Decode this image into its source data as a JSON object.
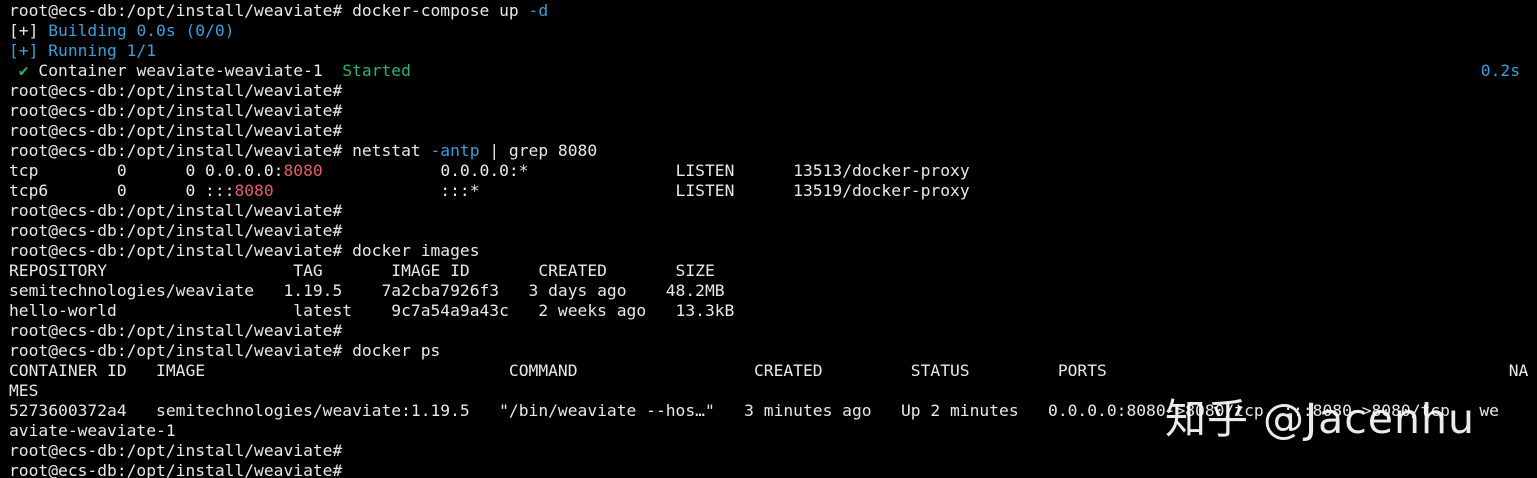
{
  "colors": {
    "background": "#000000",
    "text": "#e8e8e8",
    "blue": "#3b9fd6",
    "green": "#2fb36b",
    "red": "#e06060"
  },
  "lines": [
    [
      {
        "t": "root@ecs-db:/opt/install/weaviate# docker-compose up "
      },
      {
        "t": "-d",
        "c": "blue"
      }
    ],
    [
      {
        "t": "[+] "
      },
      {
        "t": "Building 0.0s (0/0)",
        "c": "blue"
      }
    ],
    [
      {
        "t": "[+] Running 1/1",
        "c": "blue"
      }
    ],
    [
      {
        "t": " ✔ ",
        "c": "green"
      },
      {
        "t": "Container weaviate-weaviate-1  "
      },
      {
        "t": "Started",
        "c": "green"
      }
    ],
    [
      {
        "t": "root@ecs-db:/opt/install/weaviate#"
      }
    ],
    [
      {
        "t": "root@ecs-db:/opt/install/weaviate#"
      }
    ],
    [
      {
        "t": "root@ecs-db:/opt/install/weaviate#"
      }
    ],
    [
      {
        "t": "root@ecs-db:/opt/install/weaviate# netstat "
      },
      {
        "t": "-antp",
        "c": "blue"
      },
      {
        "t": " | grep 8080"
      }
    ],
    [
      {
        "t": "tcp        0      0 0.0.0.0:"
      },
      {
        "t": "8080",
        "c": "red"
      },
      {
        "t": "            0.0.0.0:*               LISTEN      13513/docker-proxy"
      }
    ],
    [
      {
        "t": "tcp6       0      0 :::"
      },
      {
        "t": "8080",
        "c": "red"
      },
      {
        "t": "                 :::*                    LISTEN      13519/docker-proxy"
      }
    ],
    [
      {
        "t": "root@ecs-db:/opt/install/weaviate#"
      }
    ],
    [
      {
        "t": "root@ecs-db:/opt/install/weaviate#"
      }
    ],
    [
      {
        "t": "root@ecs-db:/opt/install/weaviate# docker images"
      }
    ],
    [
      {
        "t": "REPOSITORY                   TAG       IMAGE ID       CREATED       SIZE"
      }
    ],
    [
      {
        "t": "semitechnologies/weaviate   1.19.5    7a2cba7926f3   3 days ago    48.2MB"
      }
    ],
    [
      {
        "t": "hello-world                  latest    9c7a54a9a43c   2 weeks ago   13.3kB"
      }
    ],
    [
      {
        "t": "root@ecs-db:/opt/install/weaviate#"
      }
    ],
    [
      {
        "t": "root@ecs-db:/opt/install/weaviate# docker ps"
      }
    ],
    [
      {
        "t": "CONTAINER ID   IMAGE                               COMMAND                  CREATED         STATUS         PORTS                                         NA"
      }
    ],
    [
      {
        "t": "MES"
      }
    ],
    [
      {
        "t": "5273600372a4   semitechnologies/weaviate:1.19.5   \"/bin/weaviate --hos…\"   3 minutes ago   Up 2 minutes   0.0.0.0:8080->8080/tcp, :::8080->8080/tcp   we"
      }
    ],
    [
      {
        "t": "aviate-weaviate-1"
      }
    ],
    [
      {
        "t": "root@ecs-db:/opt/install/weaviate#"
      }
    ],
    [
      {
        "t": "root@ecs-db:/opt/install/weaviate#"
      }
    ]
  ],
  "right_status": {
    "text": "0.2s",
    "line": 3,
    "color": "blue"
  },
  "watermark": "知乎 @Jacenhu"
}
